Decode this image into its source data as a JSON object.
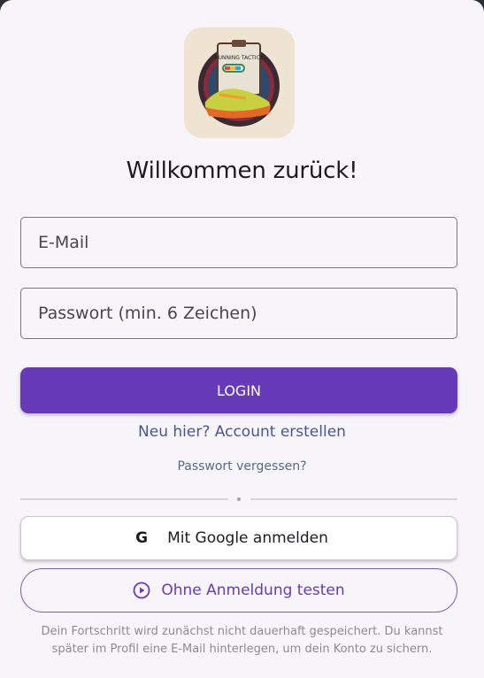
{
  "dialog": {
    "title": "Willkommen zurück!",
    "logo_text": "RUNNING TACTICS"
  },
  "form": {
    "email_placeholder": "E-Mail",
    "password_placeholder": "Passwort (min. 6 Zeichen)",
    "login_label": "LOGIN"
  },
  "links": {
    "create_account": "Neu hier? Account erstellen",
    "forgot_password": "Passwort vergessen?"
  },
  "social": {
    "google_icon": "G",
    "google_label": "Mit Google anmelden",
    "guest_label": "Ohne Anmeldung testen"
  },
  "note": "Dein Fortschritt wird zunächst nicht dauerhaft gespeichert. Du kannst später im Profil eine E-Mail hinterlegen, um dein Konto zu sichern.",
  "colors": {
    "primary": "#673ab7",
    "background": "#f7f5fa"
  }
}
